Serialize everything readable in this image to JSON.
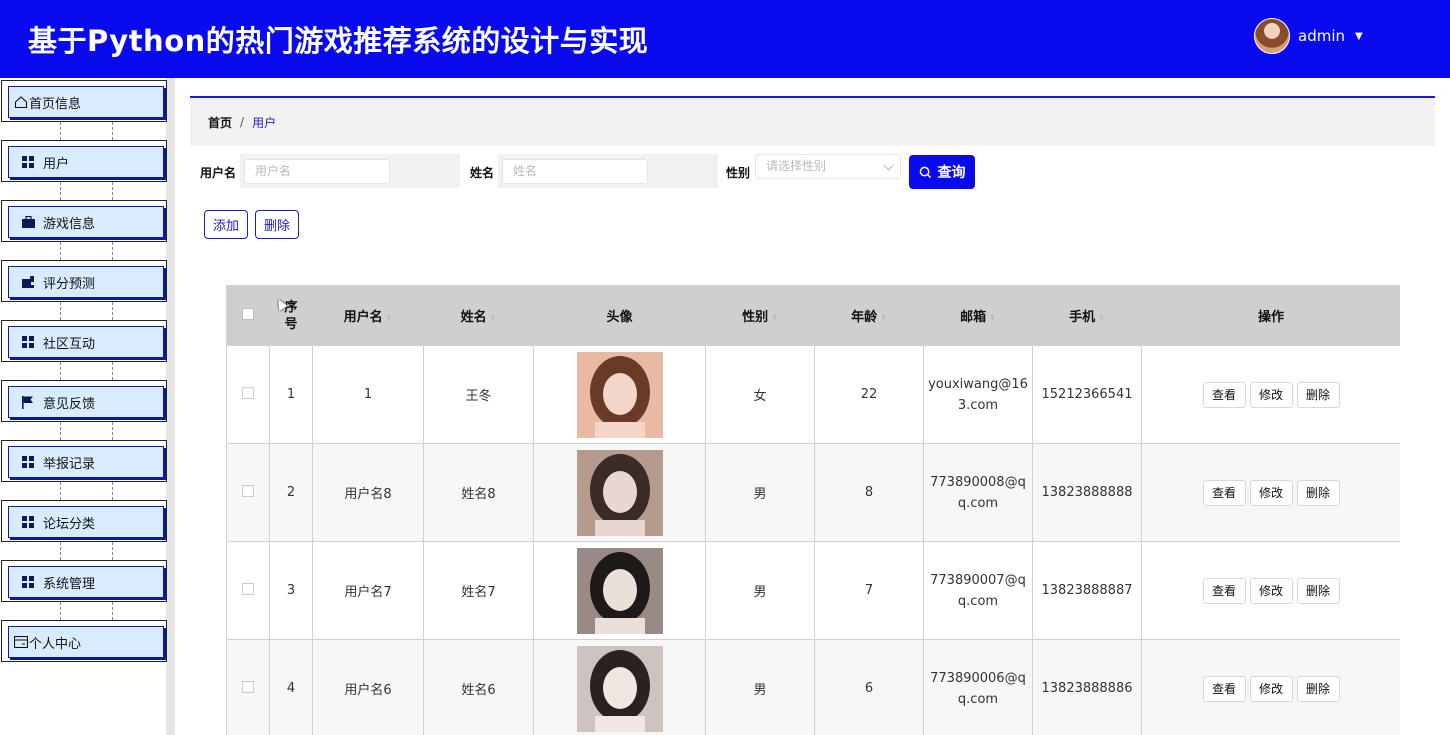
{
  "header": {
    "title": "基于Python的热门游戏推荐系统的设计与实现",
    "username": "admin",
    "bg_color": "#0a0aee"
  },
  "sidebar": {
    "items": [
      {
        "label": "首页信息",
        "icon": "home-icon"
      },
      {
        "label": "用户",
        "icon": "grid-icon"
      },
      {
        "label": "游戏信息",
        "icon": "briefcase-icon"
      },
      {
        "label": "评分预测",
        "icon": "wallet-icon"
      },
      {
        "label": "社区互动",
        "icon": "grid-icon"
      },
      {
        "label": "意见反馈",
        "icon": "flag-icon"
      },
      {
        "label": "举报记录",
        "icon": "grid-icon"
      },
      {
        "label": "论坛分类",
        "icon": "grid-icon"
      },
      {
        "label": "系统管理",
        "icon": "grid-icon"
      },
      {
        "label": "个人中心",
        "icon": "card-icon"
      }
    ]
  },
  "breadcrumb": {
    "home": "首页",
    "separator": "/",
    "current": "用户"
  },
  "filters": {
    "username_label": "用户名",
    "username_placeholder": "用户名",
    "name_label": "姓名",
    "name_placeholder": "姓名",
    "gender_label": "性别",
    "gender_placeholder": "请选择性别",
    "query_label": "查询"
  },
  "actions": {
    "add_label": "添加",
    "delete_label": "删除"
  },
  "table": {
    "headers": {
      "index": "序号",
      "username": "用户名",
      "name": "姓名",
      "avatar": "头像",
      "gender": "性别",
      "age": "年龄",
      "email": "邮箱",
      "phone": "手机",
      "ops": "操作"
    },
    "rows": [
      {
        "index": "1",
        "username": "1",
        "name": "王冬",
        "gender": "女",
        "age": "22",
        "email": "youxiwang@163.com",
        "phone": "15212366541"
      },
      {
        "index": "2",
        "username": "用户名8",
        "name": "姓名8",
        "gender": "男",
        "age": "8",
        "email": "773890008@qq.com",
        "phone": "13823888888"
      },
      {
        "index": "3",
        "username": "用户名7",
        "name": "姓名7",
        "gender": "男",
        "age": "7",
        "email": "773890007@qq.com",
        "phone": "13823888887"
      },
      {
        "index": "4",
        "username": "用户名6",
        "name": "姓名6",
        "gender": "男",
        "age": "6",
        "email": "773890006@qq.com",
        "phone": "13823888886"
      }
    ],
    "op_view": "查看",
    "op_edit": "修改",
    "op_delete": "删除"
  }
}
